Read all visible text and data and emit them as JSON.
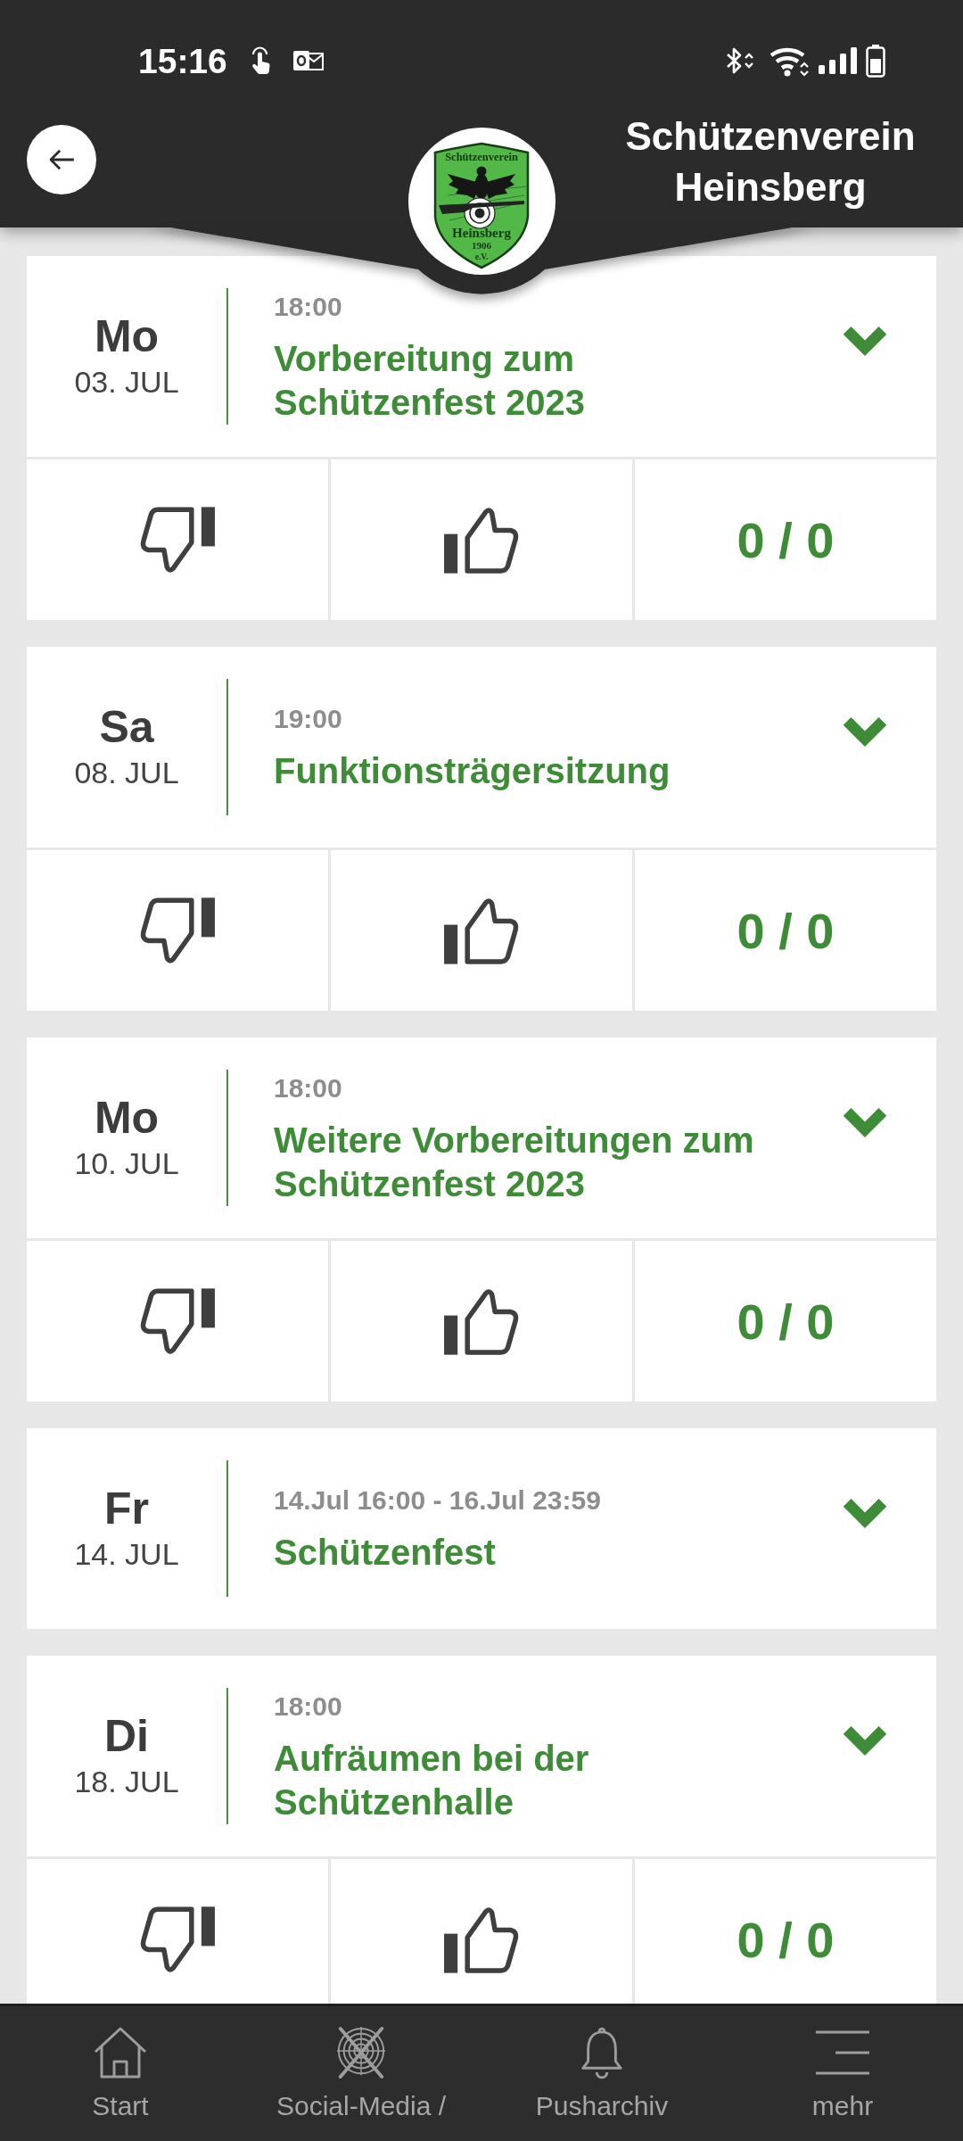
{
  "status_bar": {
    "time": "15:16"
  },
  "header": {
    "title": "Schützenverein Heinsberg",
    "logo": {
      "top_text": "Schützenverein",
      "name": "Heinsberg",
      "year": "1906",
      "suffix": "e.V."
    }
  },
  "events": [
    {
      "weekday": "Mo",
      "date": "03. JUL",
      "time": "18:00",
      "title": "Vorbereitung zum Schützenfest 2023",
      "attendance": "0 / 0"
    },
    {
      "weekday": "Sa",
      "date": "08. JUL",
      "time": "19:00",
      "title": "Funktionsträgersitzung",
      "attendance": "0 / 0"
    },
    {
      "weekday": "Mo",
      "date": "10. JUL",
      "time": "18:00",
      "title": "Weitere Vorbereitungen zum Schützenfest 2023",
      "attendance": "0 / 0"
    },
    {
      "weekday": "Fr",
      "date": "14. JUL",
      "time": "14.Jul 16:00 - 16.Jul 23:59",
      "title": "Schützenfest"
    },
    {
      "weekday": "Di",
      "date": "18. JUL",
      "time": "18:00",
      "title": "Aufräumen bei der Schützenhalle",
      "attendance": "0 / 0"
    }
  ],
  "bottom_nav": [
    {
      "kind": "home",
      "label": "Start"
    },
    {
      "kind": "target",
      "label": "Social-Media /"
    },
    {
      "kind": "bell",
      "label": "Pusharchiv"
    },
    {
      "kind": "menu",
      "label": "mehr"
    }
  ]
}
